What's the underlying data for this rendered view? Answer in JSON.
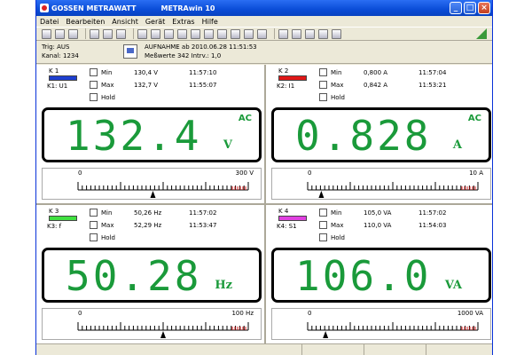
{
  "window": {
    "brand": "GOSSEN METRAWATT",
    "app": "METRAwin 10"
  },
  "menu": [
    "Datei",
    "Bearbeiten",
    "Ansicht",
    "Gerät",
    "Extras",
    "Hilfe"
  ],
  "info": {
    "trig": "Trig: AUS",
    "kanal": "Kanal: 1234",
    "recording": "AUFNAHME ab 2010.06.28 11:51:53",
    "measurements": "Meßwerte 342   Intrv.: 1,0"
  },
  "options": [
    "Min",
    "Max",
    "Hold"
  ],
  "channels": [
    {
      "label": "K 1",
      "desc": "K1: U1",
      "color": "#1e3fd0",
      "min_value": "130,4  V",
      "min_time": "11:57:10",
      "max_value": "132,7  V",
      "max_time": "11:55:07",
      "display": "132.4",
      "unit": "V",
      "ac": "AC",
      "scale_min": "0",
      "scale_max": "300 V",
      "pointer": 0.44
    },
    {
      "label": "K 2",
      "desc": "K2: I1",
      "color": "#e01818",
      "min_value": "0,800  A",
      "min_time": "11:57:04",
      "max_value": "0,842  A",
      "max_time": "11:53:21",
      "display": "0.828",
      "unit": "A",
      "ac": "AC",
      "scale_min": "0",
      "scale_max": "10 A",
      "pointer": 0.08
    },
    {
      "label": "K 3",
      "desc": "K3: f",
      "color": "#40e040",
      "min_value": "50,26  Hz",
      "min_time": "11:57:02",
      "max_value": "52,29  Hz",
      "max_time": "11:53:47",
      "display": "50.28",
      "unit": "Hz",
      "ac": "",
      "scale_min": "0",
      "scale_max": "100 Hz",
      "pointer": 0.5
    },
    {
      "label": "K 4",
      "desc": "K4: S1",
      "color": "#e040e0",
      "min_value": "105,0  VA",
      "min_time": "11:57:02",
      "max_value": "110,0  VA",
      "max_time": "11:54:03",
      "display": "106.0",
      "unit": "VA",
      "ac": "",
      "scale_min": "0",
      "scale_max": "1000 VA",
      "pointer": 0.105
    }
  ]
}
